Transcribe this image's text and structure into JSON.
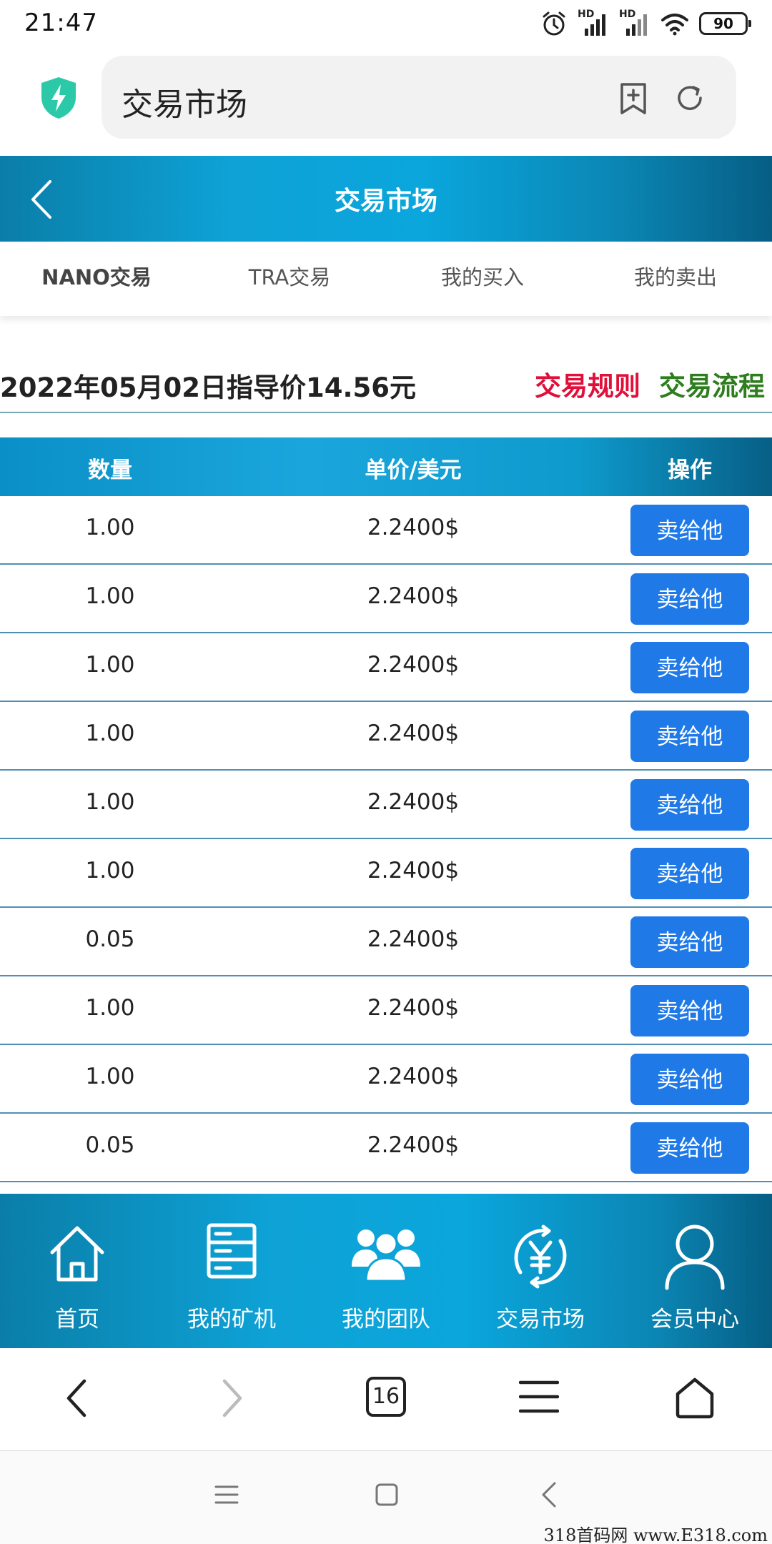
{
  "status_bar": {
    "time": "21:47",
    "battery": "90",
    "network_label": "HD"
  },
  "browser": {
    "address_text": "交易市场",
    "tab_count": "16"
  },
  "header": {
    "title": "交易市场"
  },
  "tabs": [
    {
      "label": "NANO交易",
      "active": true
    },
    {
      "label": "TRA交易",
      "active": false
    },
    {
      "label": "我的买入",
      "active": false
    },
    {
      "label": "我的卖出",
      "active": false
    }
  ],
  "guide": {
    "text": "2022年05月02日指导价14.56元",
    "rules_link": "交易规则",
    "process_link": "交易流程"
  },
  "table": {
    "headers": {
      "qty": "数量",
      "price": "单价/美元",
      "op": "操作"
    },
    "rows": [
      {
        "qty": "1.00",
        "price": "2.2400$",
        "action": "卖给他"
      },
      {
        "qty": "1.00",
        "price": "2.2400$",
        "action": "卖给他"
      },
      {
        "qty": "1.00",
        "price": "2.2400$",
        "action": "卖给他"
      },
      {
        "qty": "1.00",
        "price": "2.2400$",
        "action": "卖给他"
      },
      {
        "qty": "1.00",
        "price": "2.2400$",
        "action": "卖给他"
      },
      {
        "qty": "1.00",
        "price": "2.2400$",
        "action": "卖给他"
      },
      {
        "qty": "0.05",
        "price": "2.2400$",
        "action": "卖给他"
      },
      {
        "qty": "1.00",
        "price": "2.2400$",
        "action": "卖给他"
      },
      {
        "qty": "1.00",
        "price": "2.2400$",
        "action": "卖给他"
      },
      {
        "qty": "0.05",
        "price": "2.2400$",
        "action": "卖给他"
      }
    ]
  },
  "bottom_nav": [
    {
      "label": "首页",
      "icon": "home-icon"
    },
    {
      "label": "我的矿机",
      "icon": "server-icon"
    },
    {
      "label": "我的团队",
      "icon": "team-icon"
    },
    {
      "label": "交易市场",
      "icon": "yuan-exchange-icon"
    },
    {
      "label": "会员中心",
      "icon": "user-icon"
    }
  ],
  "watermark": "318首码网 www.E318.com"
}
